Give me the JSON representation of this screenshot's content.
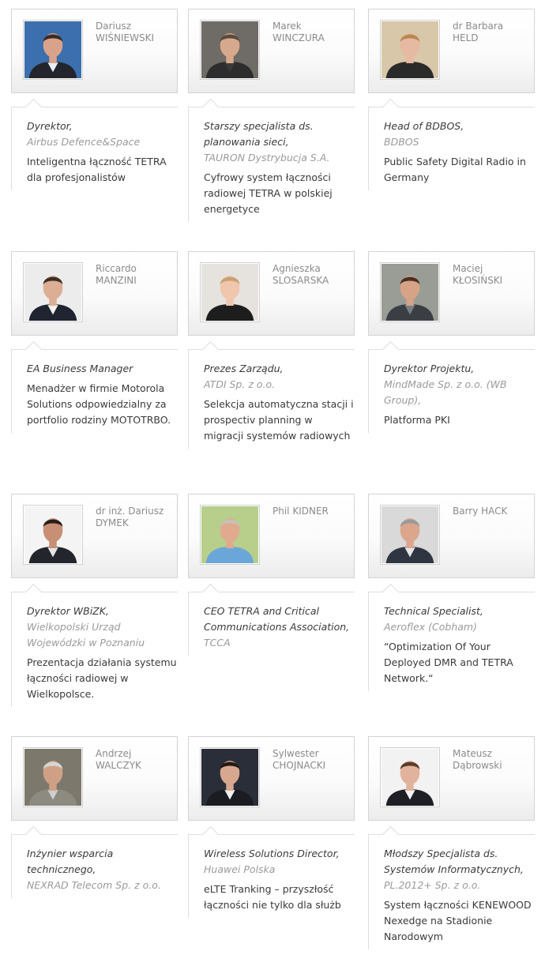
{
  "speakers": [
    {
      "first": "Dariusz",
      "last": "WIŚNIEWSKI",
      "role": "Dyrektor,",
      "company": "Airbus Defence&Space",
      "talk": "Inteligentna łączność TETRA dla profesjonalistów",
      "photo": {
        "bg": "#3b6fae",
        "skin": "#d9a28a",
        "hair": "#3a2a22",
        "suit": "#23252c",
        "shirt": "#e8eef5"
      }
    },
    {
      "first": "Marek",
      "last": "WINCZURA",
      "role": "Starszy specjalista ds. planowania sieci,",
      "company": "TAURON Dystrybucja S.A.",
      "talk": "Cyfrowy system łączności radiowej TETRA w polskiej energetyce",
      "photo": {
        "bg": "#6f6b66",
        "skin": "#d7a98c",
        "hair": "#5a4a3c",
        "suit": "#2d2d2d",
        "shirt": "#3a3a3a"
      }
    },
    {
      "first": "dr Barbara",
      "last": "HELD",
      "role": "Head of BDBOS,",
      "company": "BDBOS",
      "talk": "Public Safety Digital Radio in Germany",
      "photo": {
        "bg": "#d8c7a8",
        "skin": "#e5b9a2",
        "hair": "#b9884e",
        "suit": "#2a2a2a",
        "shirt": "#2a2a2a"
      }
    },
    {
      "first": "Riccardo",
      "last": "MANZINI",
      "role": "EA Business Manager",
      "company": "",
      "talk": "Menadżer w firmie Motorola Solutions odpowiedzialny za portfolio rodziny MOTOTRBO.",
      "photo": {
        "bg": "#ececec",
        "skin": "#dcae93",
        "hair": "#3e2e24",
        "suit": "#1f2430",
        "shirt": "#f2f2f2"
      }
    },
    {
      "first": "Agnieszka",
      "last": "SLOSARSKA",
      "role": "Prezes Zarządu,",
      "company": "ATDI Sp. z o.o.",
      "talk": "Selekcja automatyczna stacji i prospectiv planning w migracji systemów radiowych",
      "photo": {
        "bg": "#e6e3df",
        "skin": "#f0c7ad",
        "hair": "#c9a070",
        "suit": "#1d1d1d",
        "shirt": "#1d1d1d"
      }
    },
    {
      "first": "Maciej",
      "last": "KŁOSIŃSKI",
      "role": "Dyrektor Projektu,",
      "company": "MindMade Sp. z o.o. (WB Group),",
      "talk": "Platforma PKI",
      "photo": {
        "bg": "#9a9d96",
        "skin": "#d6a386",
        "hair": "#4a3022",
        "suit": "#3b3f44",
        "shirt": "#7a7f86"
      }
    },
    {
      "first": "dr inż. Dariusz",
      "last": "DYMEK",
      "role": "Dyrektor WBiZK,",
      "company": "Wielkopolski Urząd Wojewódzki w Poznaniu",
      "talk": "Prezentacja działania systemu łączności radiowej w Wielkopolsce.",
      "photo": {
        "bg": "#f4f4f4",
        "skin": "#c98f74",
        "hair": "#2a1e18",
        "suit": "#23252c",
        "shirt": "#e5e5e5"
      }
    },
    {
      "first": "",
      "last": "Phil KIDNER",
      "role": "CEO TETRA and Critical Communications Association,",
      "company": "TCCA",
      "talk": "",
      "photo": {
        "bg": "#b7cf8a",
        "skin": "#e0aa8f",
        "hair": "#c8c0b4",
        "suit": "#6aa7d8",
        "shirt": "#6aa7d8"
      }
    },
    {
      "first": "",
      "last": "Barry HACK",
      "role": "Technical Specialist,",
      "company": "Aeroflex (Cobham)",
      "talk": "“Optimization Of Your Deployed DMR and TETRA Network.“",
      "photo": {
        "bg": "#d9d9d9",
        "skin": "#dba68c",
        "hair": "#9a9a9a",
        "suit": "#2f3642",
        "shirt": "#e6e6e6"
      }
    },
    {
      "first": "Andrzej",
      "last": "WALCZYK",
      "role": "Inżynier wsparcia technicznego,",
      "company": "NEXRAD Telecom Sp. z o.o.",
      "talk": "",
      "photo": {
        "bg": "#7c786c",
        "skin": "#cfa086",
        "hair": "#d6d6d6",
        "suit": "#8d8a80",
        "shirt": "#cfcfcf"
      }
    },
    {
      "first": "Sylwester",
      "last": "CHOJNACKI",
      "role": "Wireless Solutions Director,",
      "company": "Huawei Polska",
      "talk": "eLTE Tranking – przyszłość łączności nie tylko dla służb",
      "photo": {
        "bg": "#2a2e38",
        "skin": "#d7a88f",
        "hair": "#231a15",
        "suit": "#1a1c22",
        "shirt": "#f0f0f0"
      }
    },
    {
      "first": "Mateusz",
      "last": "Dąbrowski",
      "role": "Młodszy Specjalista ds. Systemów Informatycznych,",
      "company": "PL.2012+ Sp. z o.o.",
      "talk": "System łączności KENEWOOD Nexedge na Stadionie Narodowym",
      "photo": {
        "bg": "#f2f2f2",
        "skin": "#e2b39c",
        "hair": "#5b3d2a",
        "suit": "#1e2026",
        "shirt": "#f5f5f5"
      }
    }
  ]
}
